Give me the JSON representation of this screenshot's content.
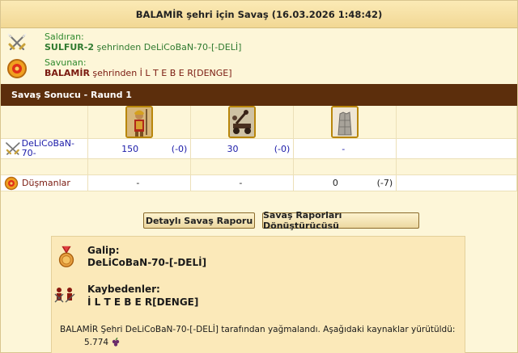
{
  "title": "BALAMİR şehri için Savaş (16.03.2026 1:48:42)",
  "attacker": {
    "role": "Saldıran:",
    "city": "SULFUR-2",
    "text": " şehrinden DeLiCoBaN-70-[-DELİ]"
  },
  "defender": {
    "role": "Savunan:",
    "city": "BALAMİR",
    "text": " şehrinden İ L T E B E R[DENGE]"
  },
  "section_title": "Savaş Sonucu - Raund 1",
  "units": {
    "attacker_name": "DeLiCoBaN-70-",
    "attacker": [
      {
        "count": "150",
        "loss": "(-0)"
      },
      {
        "count": "30",
        "loss": "(-0)"
      },
      {
        "count": "-",
        "loss": ""
      }
    ],
    "enemy_name": "Düşmanlar",
    "enemy": [
      {
        "count": "-",
        "loss": ""
      },
      {
        "count": "-",
        "loss": ""
      },
      {
        "count": "0",
        "loss": "(-7)"
      }
    ],
    "icons": [
      "spearman-unit-icon",
      "catapult-unit-icon",
      "wall-unit-icon"
    ]
  },
  "buttons": {
    "detailed_report": "Detaylı Savaş Raporu",
    "report_converter": "Savaş Raporları Dönüştürücüsü"
  },
  "result": {
    "winner_label": "Galip:",
    "winner": "DeLiCoBaN-70-[-DELİ]",
    "losers_label": "Kaybedenler:",
    "losers": "İ L T E B E R[DENGE]",
    "plunder_text": "BALAMİR Şehri DeLiCoBaN-70-[-DELİ] tarafından yağmalandı. Aşağıdaki kaynaklar yürütüldü:",
    "resource_amount": "5.774",
    "resource_icon": "wine-grapes-icon"
  },
  "colors": {
    "section_bar": "#5c2e0c",
    "background": "#fdf6d8",
    "link_blue": "#1a1aa8",
    "attacker_green": "#2f7a2f",
    "defender_red": "#7a1a10"
  }
}
